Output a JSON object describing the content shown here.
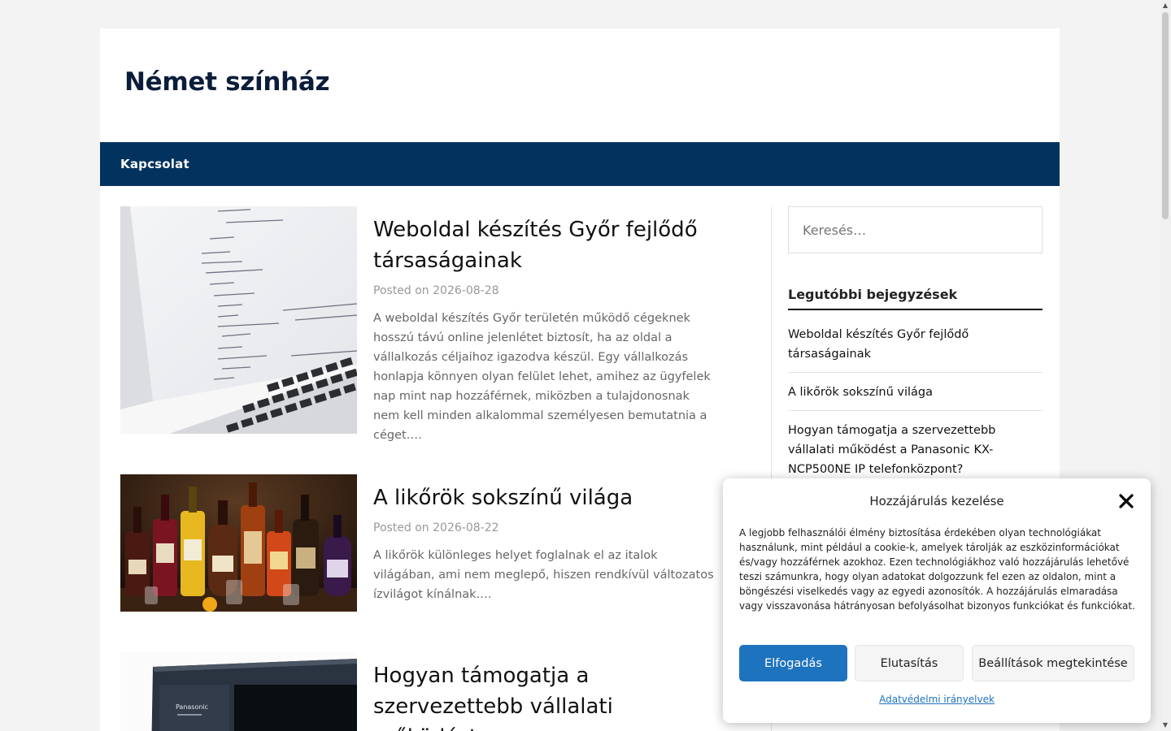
{
  "site": {
    "title": "Német színház"
  },
  "nav": {
    "items": [
      {
        "label": "Kapcsolat"
      }
    ]
  },
  "posts": [
    {
      "title": "Weboldal készítés Győr fejlődő társaságainak",
      "meta_prefix": "Posted on",
      "date": "2026-08-28",
      "excerpt": "A weboldal készítés Győr területén működő cégeknek hosszú távú online jelenlétet biztosít, ha az oldal a vállalkozás céljaihoz igazodva készül. Egy vállalkozás honlapja könnyen olyan felület lehet, amihez az ügyfelek nap mint nap hozzáférnek, miközben a tulajdonosnak nem kell minden alkalommal személyesen bemutatnia a céget.…",
      "image": "laptop-code-image"
    },
    {
      "title": "A likőrök sokszínű világa",
      "meta_prefix": "Posted on",
      "date": "2026-08-22",
      "excerpt": "A likőrök különleges helyet foglalnak el az italok világában, ami nem meglepő, hiszen rendkívül változatos ízvilágot kínálnak.…",
      "image": "liqueur-bottles-image"
    },
    {
      "title": "Hogyan támogatja a szervezettebb vállalati működést",
      "image": "panasonic-pbx-image"
    }
  ],
  "sidebar": {
    "search_placeholder": "Keresés…",
    "recent_title": "Legutóbbi bejegyzések",
    "recent_posts": [
      "Weboldal készítés Győr fejlődő társaságainak",
      "A likőrök sokszínű világa",
      "Hogyan támogatja a szervezettebb vállalati működést a Panasonic KX-NCP500NE IP telefonközpont?"
    ]
  },
  "cookie": {
    "title": "Hozzájárulás kezelése",
    "text": "A legjobb felhasználói élmény biztosítása érdekében olyan technológiákat használunk, mint például a cookie-k, amelyek tárolják az eszközinformációkat és/vagy hozzáférnek azokhoz. Ezen technológiákhoz való hozzájárulás lehetővé teszi számunkra, hogy olyan adatokat dolgozzunk fel ezen az oldalon, mint a böngészési viselkedés vagy az egyedi azonosítók. A hozzájárulás elmaradása vagy visszavonása hátrányosan befolyásolhat bizonyos funkciókat és funkciókat.",
    "accept_label": "Elfogadás",
    "deny_label": "Elutasítás",
    "settings_label": "Beállítások megtekintése",
    "policy_link": "Adatvédelmi irányelvek",
    "accent_color": "#1e73be"
  },
  "colors": {
    "nav_bg": "#02335e",
    "page_bg": "#f3f3f3"
  }
}
